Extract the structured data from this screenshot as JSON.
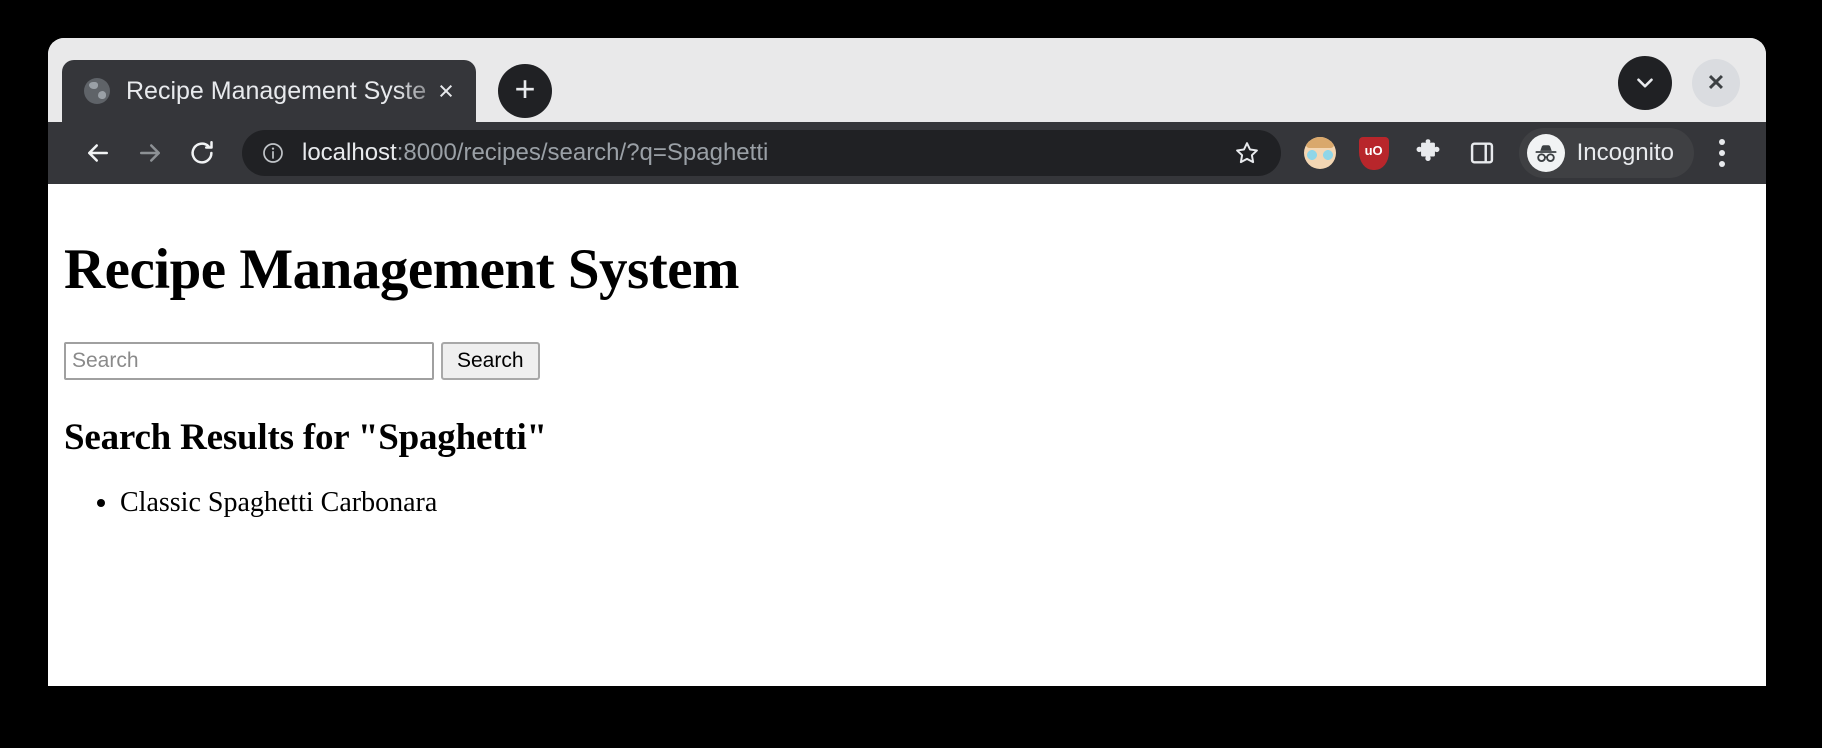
{
  "browser": {
    "tab": {
      "title": "Recipe Management Syste",
      "favicon": "globe-icon",
      "close_label": "×"
    },
    "new_tab_label": "+",
    "tab_search_icon": "chevron-down-icon",
    "window_close_label": "✕",
    "nav": {
      "back_icon": "arrow-left-icon",
      "forward_icon": "arrow-right-icon",
      "reload_icon": "reload-icon"
    },
    "omnibox": {
      "site_info_icon": "info-circle-icon",
      "url_host": "localhost",
      "url_path": ":8000/recipes/search/?q=Spaghetti",
      "bookmark_icon": "star-icon"
    },
    "toolbar_icons": [
      "extension-avatar-icon",
      "ublock-origin-icon",
      "puzzle-extensions-icon",
      "side-panel-icon"
    ],
    "ublock_label": "uO",
    "incognito": {
      "icon": "incognito-hat-glasses-icon",
      "label": "Incognito"
    },
    "menu_icon": "three-dot-menu-icon"
  },
  "page": {
    "title": "Recipe Management System",
    "search": {
      "placeholder": "Search",
      "value": "",
      "submit_label": "Search"
    },
    "results_heading": "Search Results for \"Spaghetti\"",
    "results": [
      "Classic Spaghetti Carbonara"
    ]
  }
}
